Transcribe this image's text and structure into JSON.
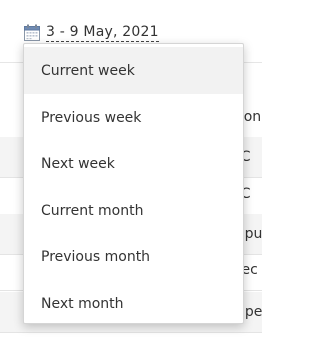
{
  "date_picker": {
    "range_label": "3 - 9 May, 2021",
    "icon": "calendar-icon"
  },
  "menu": {
    "items": [
      {
        "label": "Current week",
        "active": true
      },
      {
        "label": "Previous week",
        "active": false
      },
      {
        "label": "Next week",
        "active": false
      },
      {
        "label": "Current month",
        "active": false
      },
      {
        "label": "Previous month",
        "active": false
      },
      {
        "label": "Next month",
        "active": false
      }
    ]
  },
  "background_rows": [
    {
      "text": "con"
    },
    {
      "text": "/C"
    },
    {
      "text": "/C"
    },
    {
      "text": "epu"
    },
    {
      "text": "tec"
    },
    {
      "text": "upe"
    }
  ],
  "colors": {
    "menu_active_bg": "#f2f2f2",
    "text": "#333333",
    "row_shade": "#f4f4f4"
  }
}
